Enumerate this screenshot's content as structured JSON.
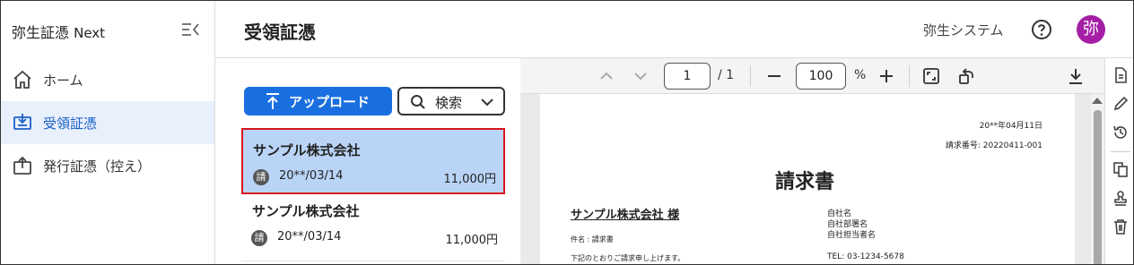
{
  "sidebar": {
    "brand_main": "弥生証憑",
    "brand_suffix": "Next",
    "collapse_icon": "collapse-sidebar-icon",
    "items": [
      {
        "label": "ホーム",
        "icon": "home-icon",
        "active": false
      },
      {
        "label": "受領証憑",
        "icon": "received-voucher-icon",
        "active": true
      },
      {
        "label": "発行証憑（控え）",
        "icon": "issued-voucher-icon",
        "active": false
      }
    ]
  },
  "header": {
    "title": "受領証憑",
    "organization": "弥生システム",
    "help_icon": "help-icon",
    "avatar_initial": "弥",
    "avatar_color": "#a51fa6"
  },
  "list": {
    "upload_label": "アップロード",
    "search_label": "検索",
    "items": [
      {
        "name": "サンプル株式会社",
        "kind_badge": "請",
        "date": "20**/03/14",
        "amount": "11,000円",
        "selected": true
      },
      {
        "name": "サンプル株式会社",
        "kind_badge": "請",
        "date": "20**/03/14",
        "amount": "11,000円",
        "selected": false
      }
    ]
  },
  "viewer": {
    "current_page": "1",
    "total_pages": "/ 1",
    "zoom": "100",
    "zoom_unit": "%"
  },
  "document": {
    "date": "20**年04月11日",
    "invoice_number": "請求番号: 20220411-001",
    "title": "請求書",
    "customer": "サンプル株式会社 様",
    "subject": "件名 : 請求書",
    "message": "下記のとおりご請求申し上げます。",
    "company_name": "自社名",
    "company_dept": "自社部署名",
    "company_person": "自社担当者名",
    "company_tel": "TEL: 03-1234-5678"
  },
  "colors": {
    "accent": "#1a6fe0",
    "selected_bg": "#b9d4f7",
    "selected_border": "#d9141f",
    "nav_active_bg": "#e8f0fb"
  }
}
